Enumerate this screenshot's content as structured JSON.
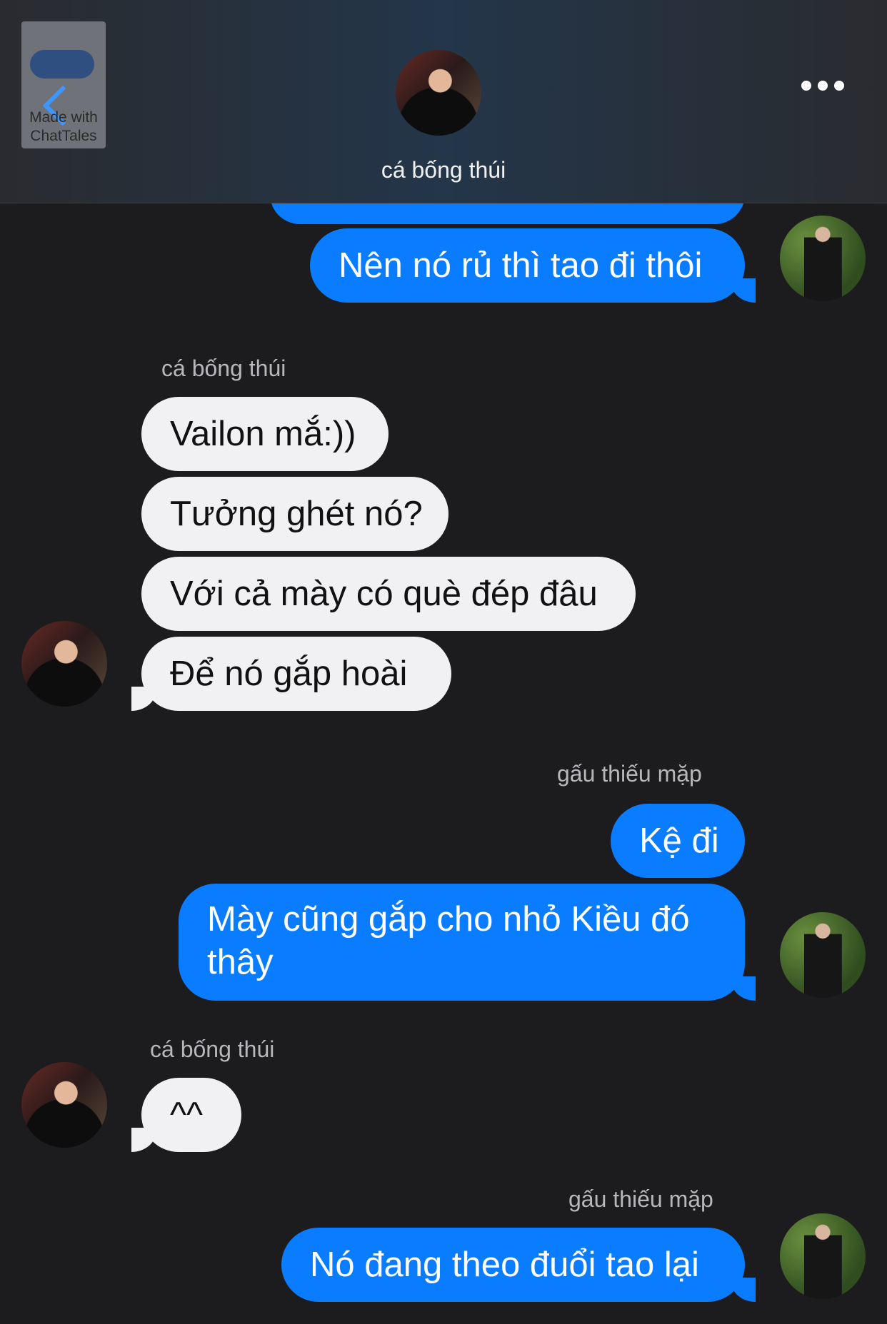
{
  "header": {
    "badge_text": "Made with ChatTales",
    "contact_name": "cá bống thúi"
  },
  "messages": {
    "m1": "Nên nó rủ thì tao đi thôi",
    "sender1": "cá bống thúi",
    "m2": "Vailon mắ:))",
    "m3": "Tưởng ghét nó?",
    "m4": "Với cả mày có què đép đâu",
    "m5": "Để nó gắp hoài",
    "sender2": "gấu thiếu mặp",
    "m6": "Kệ đi",
    "m7": "Mày cũng gắp cho nhỏ Kiều đó thây",
    "sender3": "cá bống thúi",
    "m8": "^^",
    "sender4": "gấu thiếu mặp",
    "m9": "Nó đang theo đuổi tao lại"
  },
  "colors": {
    "outgoing_bubble": "#0a7cff",
    "incoming_bubble": "#f1f1f3",
    "background": "#1c1c1e",
    "accent": "#3d97ff"
  },
  "icons": [
    "back-chevron-icon",
    "more-options-icon"
  ]
}
